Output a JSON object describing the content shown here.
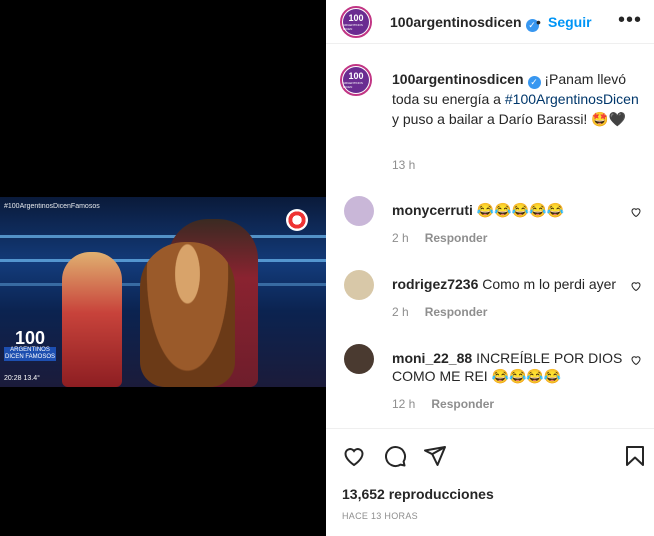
{
  "post": {
    "username": "100argentinosdicen",
    "follow_label": "Seguir",
    "dot": "•",
    "more": "•••",
    "avatar_number": "100",
    "avatar_text": "ARGENTINOS DICEN"
  },
  "caption": {
    "username": "100argentinosdicen",
    "text_before": " ¡Panam llevó toda su energía a ",
    "hashtag": "#100ArgentinosDicen",
    "text_after": " y puso a bailar a Darío Barassi! 🤩🖤",
    "time": "13 h"
  },
  "comments": [
    {
      "username": "monycerruti",
      "text": "😂😂😂😂😂",
      "time": "2 h",
      "reply": "Responder",
      "avatar_color": "#c9b7d8"
    },
    {
      "username": "rodrigez7236",
      "text": "Como m lo perdi ayer",
      "time": "2 h",
      "reply": "Responder",
      "avatar_color": "#d8c8a8"
    },
    {
      "username": "moni_22_88",
      "text": "INCREÍBLE POR DIOS COMO ME REI 😂😂😂😂",
      "time": "12 h",
      "reply": "Responder",
      "avatar_color": "#4a3a30"
    }
  ],
  "video": {
    "overlay_hashtag": "#100ArgentinosDicenFamosos",
    "show_number": "100",
    "show_sub": "ARGENTINOS DICEN FAMOSOS",
    "clock": "20:28  13.4°"
  },
  "stats": {
    "views": "13,652 reproducciones",
    "ago": "HACE 13 HORAS"
  },
  "colors": {
    "accent": "#0095f6",
    "verified": "#3897f0",
    "muted": "#8e8e8e",
    "hashtag": "#00376b"
  },
  "icons": [
    "heart-icon",
    "comment-icon",
    "share-icon",
    "bookmark-icon",
    "verified-icon",
    "more-icon"
  ]
}
